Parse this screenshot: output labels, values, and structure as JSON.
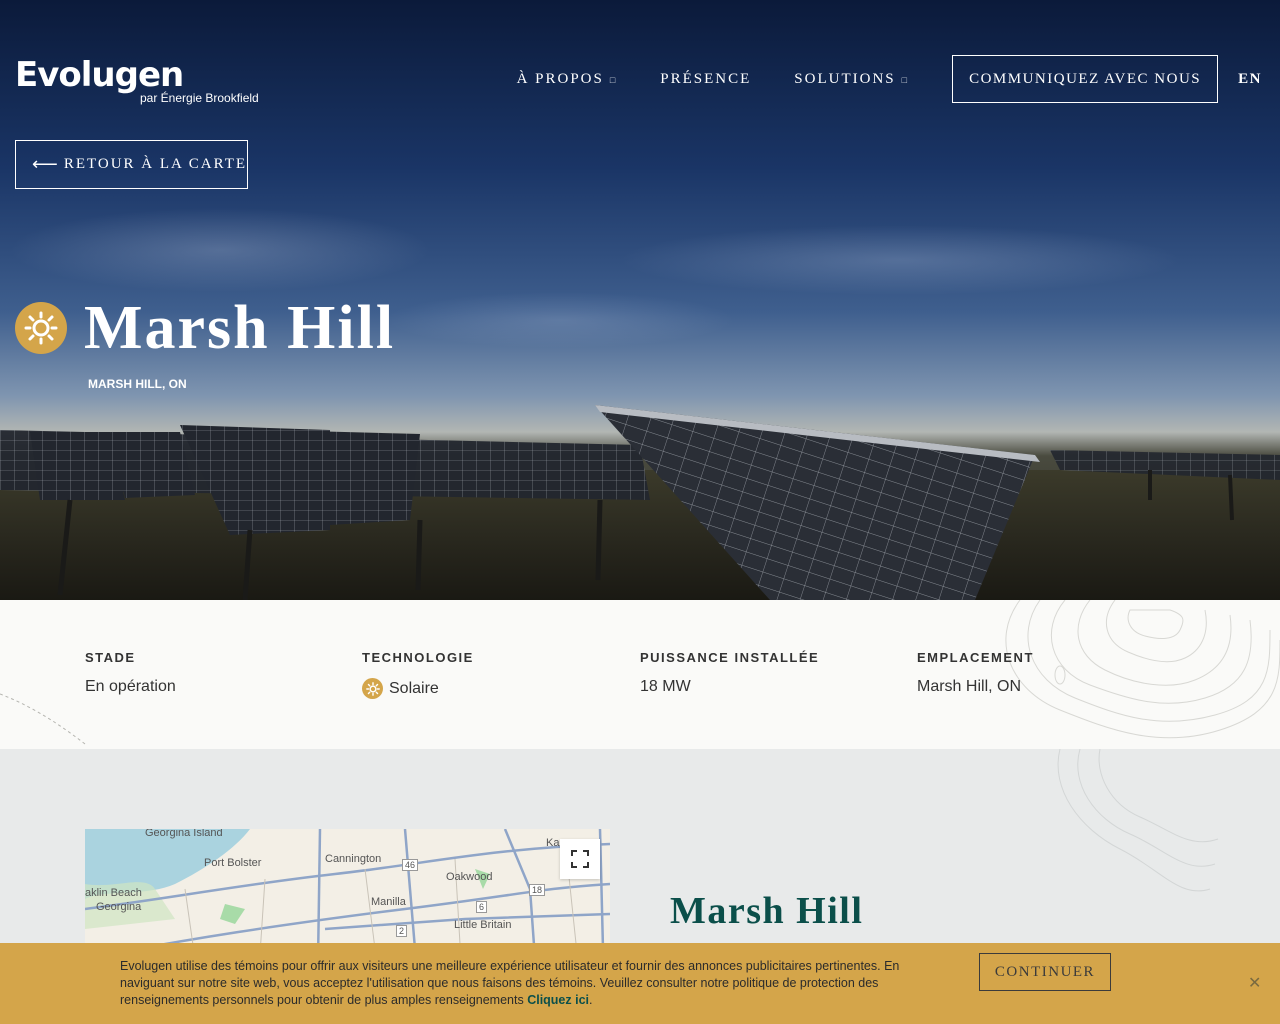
{
  "header": {
    "brand": "Evolugen",
    "brand_sub": "par Énergie Brookfield",
    "nav": [
      {
        "label": "À PROPOS",
        "caret": "□"
      },
      {
        "label": "PRÉSENCE",
        "caret": ""
      },
      {
        "label": "SOLUTIONS",
        "caret": "□"
      }
    ],
    "cta": "COMMUNIQUEZ AVEC NOUS",
    "lang": "EN"
  },
  "hero": {
    "back_arrow": "⟵",
    "back_label": "RETOUR À LA CARTE",
    "title": "Marsh Hill",
    "subtitle": "MARSH HILL, ON",
    "icon": "sun-icon"
  },
  "info": [
    {
      "label": "STADE",
      "value": "En opération"
    },
    {
      "label": "TECHNOLOGIE",
      "value": "Solaire",
      "icon": "sun-icon"
    },
    {
      "label": "PUISSANCE INSTALLÉE",
      "value": "18 MW"
    },
    {
      "label": "EMPLACEMENT",
      "value": "Marsh Hill, ON"
    }
  ],
  "map": {
    "labels": [
      "Georgina Island",
      "Port Bolster",
      "Cannington",
      "Oakwood",
      "aklin Beach",
      "Georgina",
      "Manilla",
      "Little Britain",
      "Ka"
    ],
    "route_numbers": [
      "46",
      "18",
      "6",
      "2"
    ]
  },
  "section": {
    "title": "Marsh Hill"
  },
  "cookie": {
    "text": "Evolugen utilise des témoins pour offrir aux visiteurs une meilleure expérience utilisateur et fournir des annonces publicitaires pertinentes. En naviguant sur notre site web, vous acceptez l'utilisation que nous faisons des témoins. Veuillez consulter notre politique de protection des renseignements personnels pour obtenir de plus amples renseignements ",
    "link": "Cliquez ici",
    "period": ".",
    "continue": "CONTINUER",
    "close": "✕"
  },
  "colors": {
    "gold": "#d4a54a",
    "teal": "#0b4f4a"
  }
}
